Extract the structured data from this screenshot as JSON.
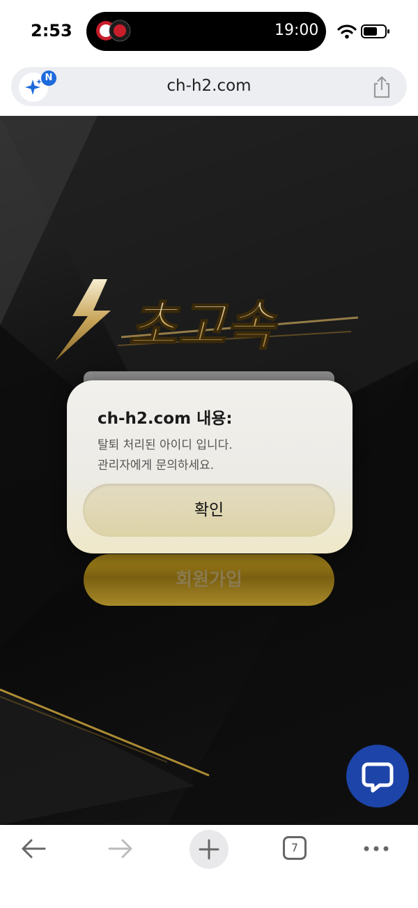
{
  "status_bar": {
    "time": "2:53",
    "island_time": "19:00",
    "icons": [
      "wifi-icon",
      "battery-icon"
    ]
  },
  "browser": {
    "url": "ch-h2.com",
    "ai_badge": "N",
    "tab_count": "7",
    "icons": [
      "sparkle-icon",
      "share-icon",
      "back-arrow-icon",
      "forward-arrow-icon",
      "plus-icon",
      "tabs-icon",
      "more-icon"
    ]
  },
  "page": {
    "logo_text": "초고속",
    "signup_label": "회원가입",
    "accent_color": "#a8871c"
  },
  "alert": {
    "title": "ch-h2.com 내용:",
    "line1": "탈퇴 처리된 아이디 입니다.",
    "line2": "관리자에게 문의하세요.",
    "confirm_label": "확인"
  },
  "chat": {
    "icon": "chat-icon",
    "color": "#1d44a8"
  }
}
